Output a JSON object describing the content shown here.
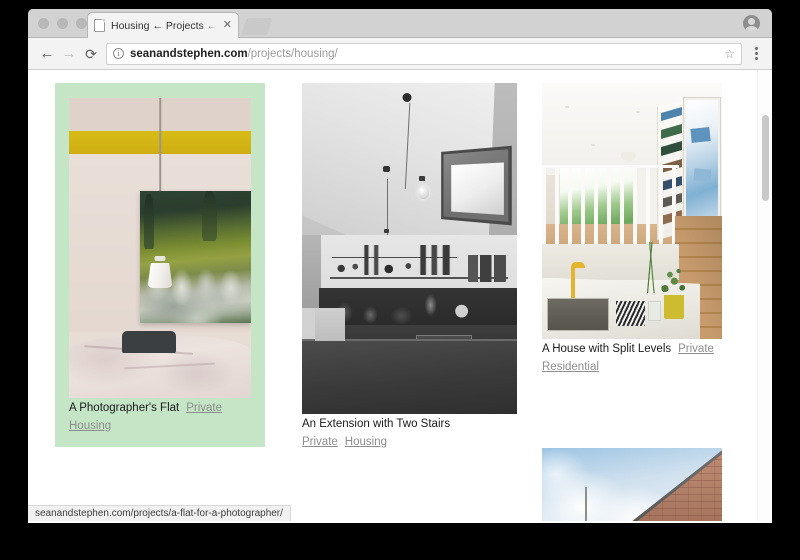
{
  "browser": {
    "tab": {
      "title": "Housing ← Projects ← Seán &",
      "close_label": "✕",
      "favicon_name": "page-favicon"
    },
    "toolbar": {
      "back_label": "←",
      "forward_label": "→",
      "reload_label": "⟳",
      "info_label": "i",
      "star_label": "☆",
      "url_host": "seanandstephen.com",
      "url_path": "/projects/housing/",
      "url_full": "seanandstephen.com/projects/housing/"
    },
    "status_bar": {
      "link_target": "seanandstephen.com/projects/a-flat-for-a-photographer/"
    }
  },
  "page": {
    "projects": [
      {
        "title": "A Photographer's Flat",
        "tags": [
          "Private",
          "Housing"
        ],
        "highlighted": true,
        "image_name": "photographers-flat-interior-photo"
      },
      {
        "title": "An Extension with Two Stairs",
        "tags": [
          "Private",
          "Housing"
        ],
        "highlighted": false,
        "image_name": "extension-two-stairs-kitchen-photo"
      },
      {
        "title": "A House with Split Levels",
        "tags": [
          "Private",
          "Residential"
        ],
        "highlighted": false,
        "image_name": "split-levels-kitchen-photo"
      },
      {
        "title": "",
        "tags": [],
        "highlighted": false,
        "image_name": "brick-gable-sky-photo"
      }
    ]
  },
  "colors": {
    "highlight_green": "#c5e5c7",
    "tag_gray": "#8d8d8d",
    "text_dark": "#1a1a1a",
    "chrome_tabstrip": "#d3d2d3",
    "chrome_toolbar": "#f4f3f4"
  }
}
